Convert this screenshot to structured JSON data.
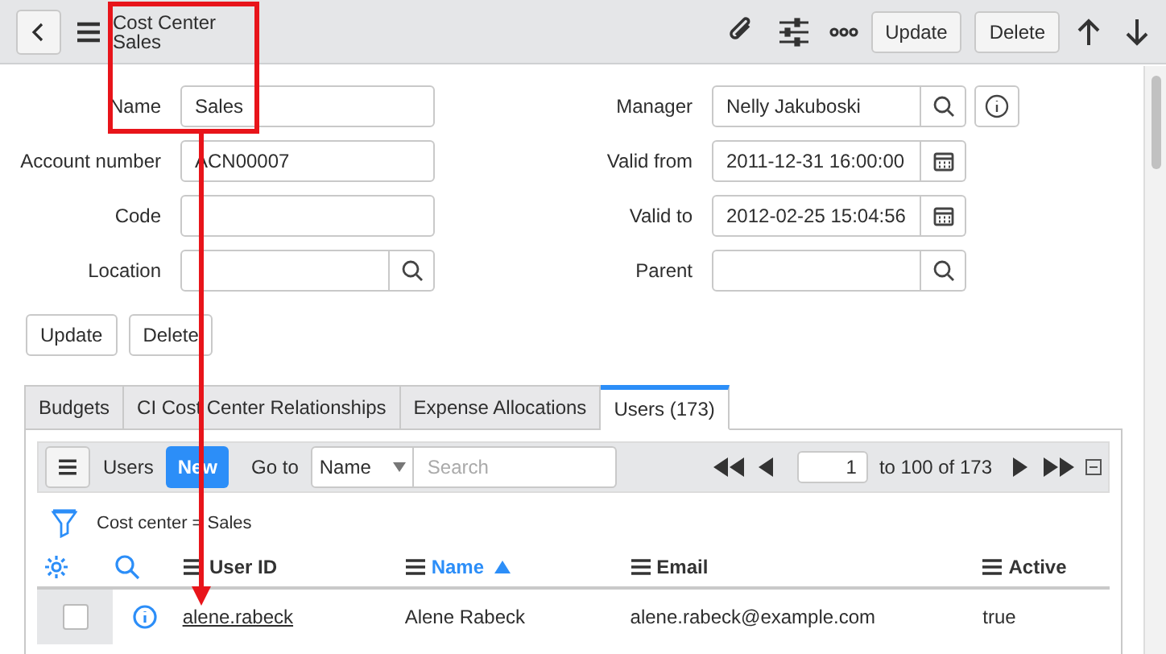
{
  "header": {
    "title": "Cost Center",
    "subtitle": "Sales",
    "buttons": [
      "Update",
      "Delete"
    ]
  },
  "form": {
    "left": [
      {
        "label": "Name",
        "value": "Sales",
        "kind": "text"
      },
      {
        "label": "Account number",
        "value": "ACN00007",
        "kind": "text"
      },
      {
        "label": "Code",
        "kind": "text"
      },
      {
        "label": "Location",
        "kind": "lookup"
      }
    ],
    "right": [
      {
        "label": "Manager",
        "value": "Nelly Jakuboski",
        "kind": "lookup",
        "info": true
      },
      {
        "label": "Valid from",
        "value": "2011-12-31 16:00:00",
        "kind": "date"
      },
      {
        "label": "Valid to",
        "value": "2012-02-25 15:04:56",
        "kind": "date"
      },
      {
        "label": "Parent",
        "kind": "lookup"
      }
    ],
    "buttons": [
      "Update",
      "Delete"
    ]
  },
  "tabs": [
    {
      "label": "Budgets",
      "selected": false
    },
    {
      "label": "CI Cost Center Relationships",
      "selected": false
    },
    {
      "label": "Expense Allocations",
      "selected": false
    },
    {
      "label": "Users (173)",
      "selected": true
    }
  ],
  "list": {
    "title": "Users",
    "new_button": "New",
    "goto_label": "Go to",
    "goto_field": "Name",
    "search_placeholder": "Search",
    "page": "1",
    "range": "to 100 of 173",
    "filter": "Cost center = Sales",
    "columns": [
      {
        "label": "User ID",
        "sorted": false
      },
      {
        "label": "Name",
        "sorted": true
      },
      {
        "label": "Email",
        "sorted": false
      },
      {
        "label": "Active",
        "sorted": false
      }
    ],
    "rows": [
      {
        "checked": false,
        "cells": [
          "alene.rabeck",
          "Alene Rabeck",
          "alene.rabeck@example.com",
          "true"
        ]
      }
    ]
  }
}
